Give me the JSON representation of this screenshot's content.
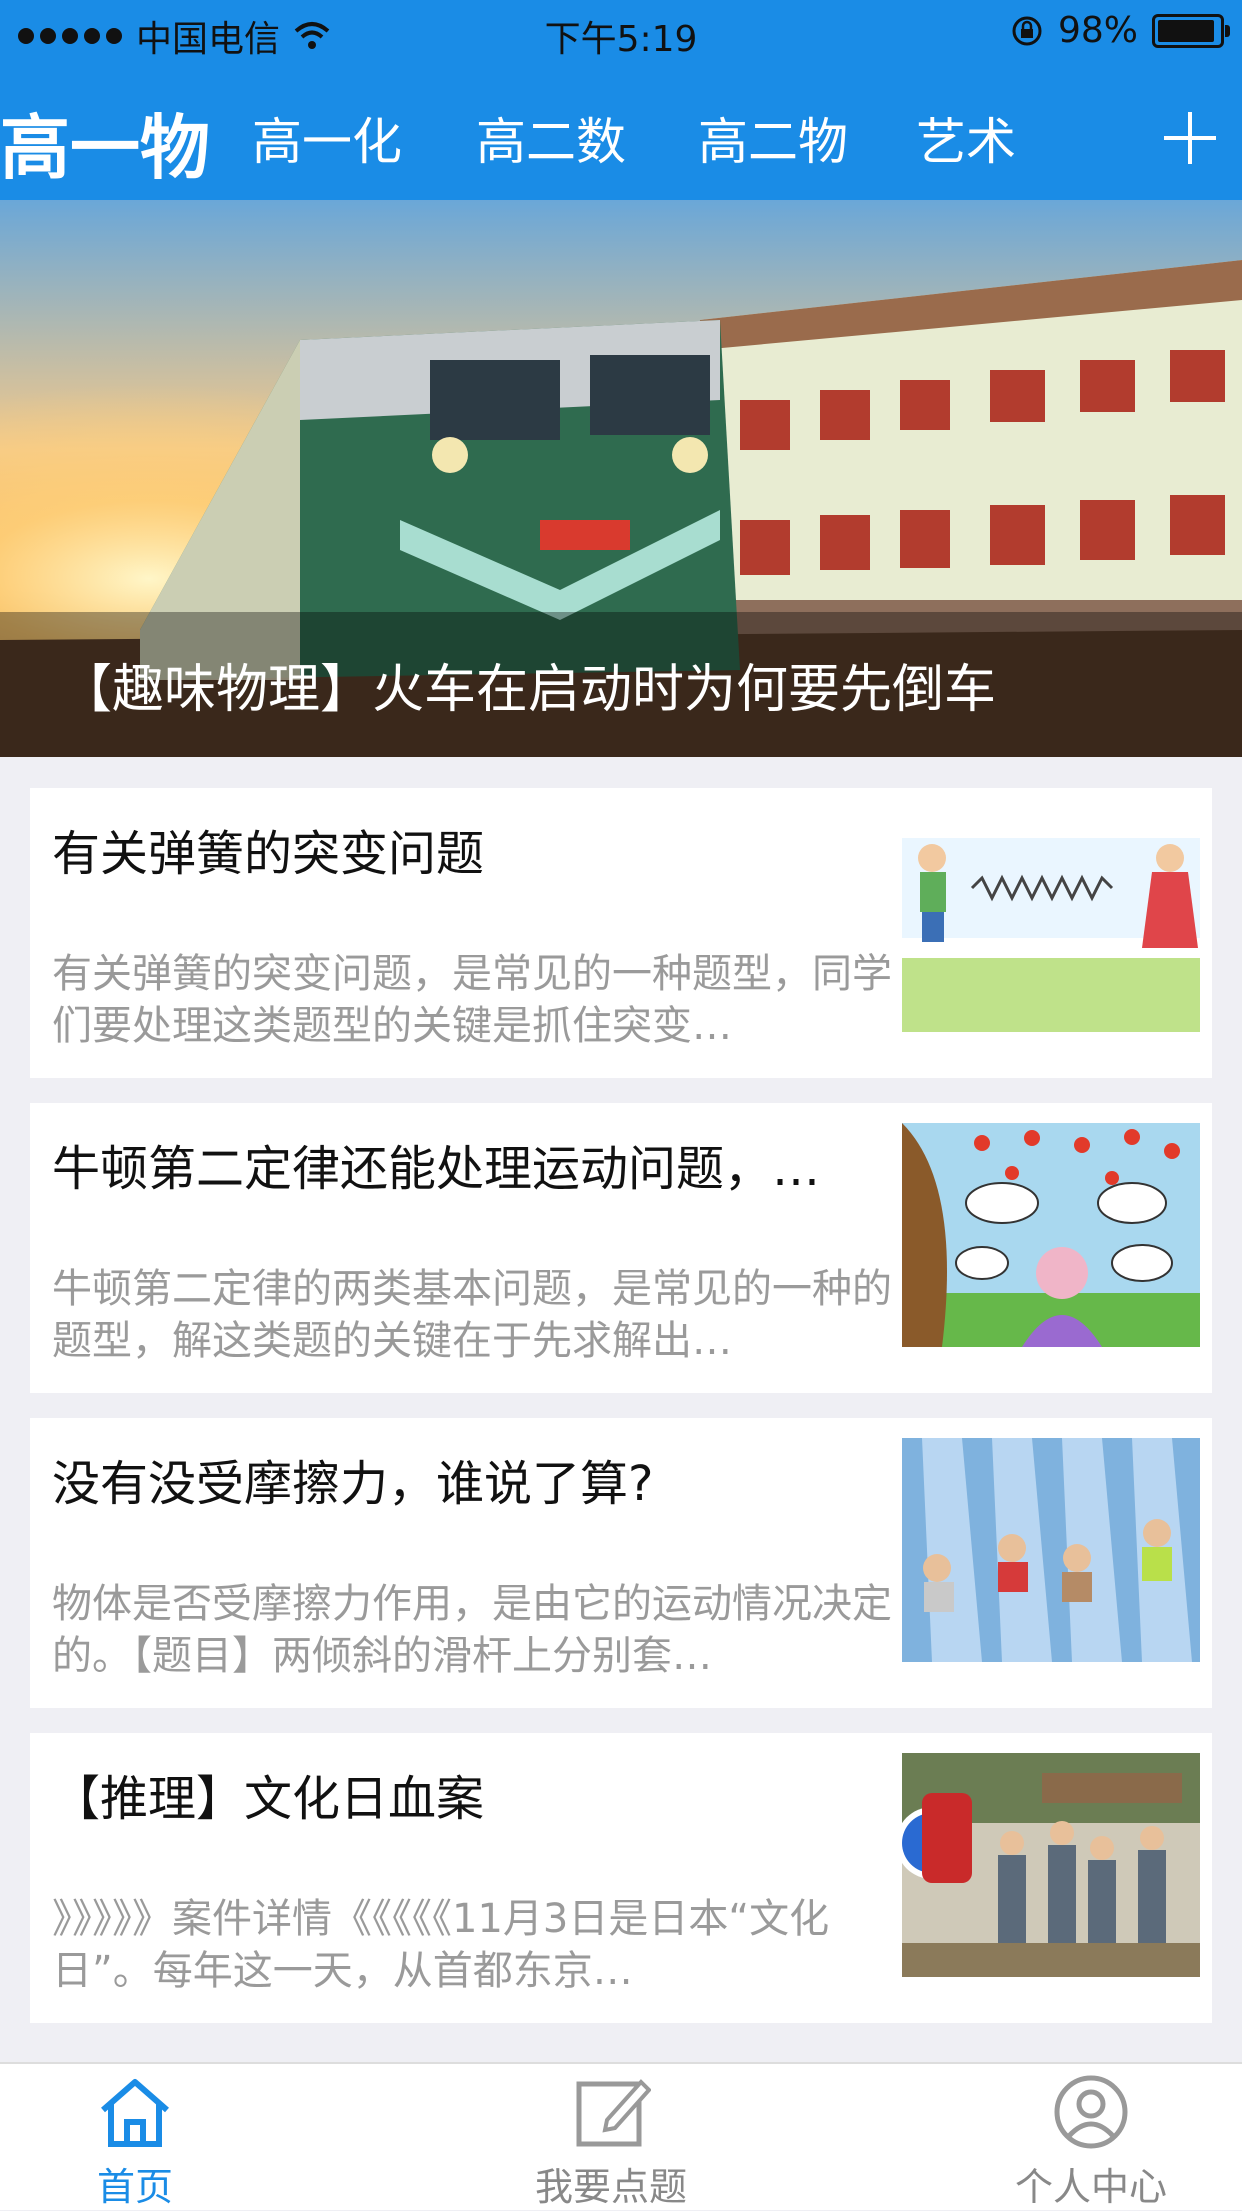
{
  "status_bar": {
    "carrier": "中国电信",
    "time": "下午5:19",
    "battery": "98%"
  },
  "nav": {
    "tabs": [
      {
        "label": "高一物",
        "active": true
      },
      {
        "label": "高一化",
        "active": false
      },
      {
        "label": "高二数",
        "active": false
      },
      {
        "label": "高二物",
        "active": false
      },
      {
        "label": "艺术",
        "active": false
      }
    ],
    "add_icon": "plus-icon"
  },
  "banner": {
    "caption": "【趣味物理】火车在启动时为何要先倒车"
  },
  "articles": [
    {
      "title": "有关弹簧的突变问题",
      "desc": "有关弹簧的突变问题，是常见的一种题型，同学们要处理这类题型的关键是抓住突变…",
      "thumb": "spring-tug-illustration"
    },
    {
      "title": "牛顿第二定律还能处理运动问题，…",
      "desc": "牛顿第二定律的两类基本问题，是常见的一种的题型，解这类题的关键在于先求解出…",
      "thumb": "newton-apple-tree-cartoon"
    },
    {
      "title": "没有没受摩擦力，谁说了算?",
      "desc": "物体是否受摩擦力作用，是由它的运动情况决定的。【题目】两倾斜的滑杆上分别套…",
      "thumb": "kids-on-slide-photo"
    },
    {
      "title": "【推理】文化日血案",
      "desc": "》》》》》案件详情《《《《《11月3日是日本“文化日”。每年这一天，从首都东京…",
      "thumb": "festival-crowd-photo"
    }
  ],
  "tabbar": {
    "items": [
      {
        "label": "首页",
        "icon": "home-icon",
        "active": true
      },
      {
        "label": "我要点题",
        "icon": "edit-icon",
        "active": false
      },
      {
        "label": "个人中心",
        "icon": "user-icon",
        "active": false
      }
    ]
  },
  "colors": {
    "brand": "#1a8ce6",
    "background": "#efeff4"
  }
}
